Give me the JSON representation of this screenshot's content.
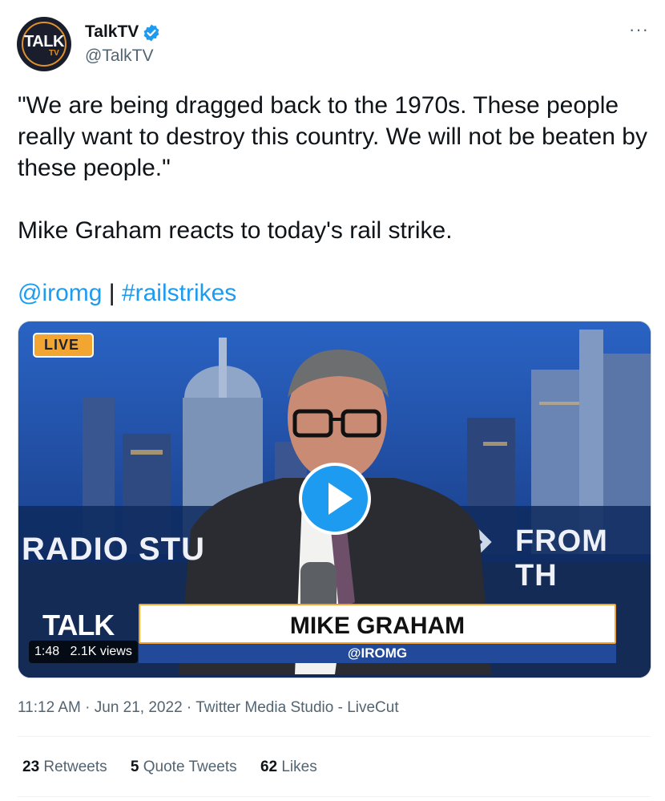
{
  "author": {
    "name": "TalkTV",
    "handle": "@TalkTV",
    "avatar_text": "TALK",
    "avatar_sub": "TV",
    "verified": true
  },
  "more_icon": "···",
  "tweet": {
    "line1": "\"We are being dragged back to the 1970s. These people really want to destroy this country. We will not be beaten by these people.\"",
    "line2": "Mike Graham reacts to today's rail strike.",
    "mention": "@iromg",
    "separator": " | ",
    "hashtag": "#railstrikes"
  },
  "video": {
    "live_label": "LIVE",
    "bg_left_text": "RADIO STU",
    "bg_right_text": "FROM TH",
    "logo_text": "TALK",
    "lower_third_name": "MIKE GRAHAM",
    "lower_third_tag": "@IROMG",
    "duration": "1:48",
    "views": "2.1K views"
  },
  "meta": {
    "time": "11:12 AM",
    "sep": " · ",
    "date": "Jun 21, 2022",
    "source": "Twitter Media Studio - LiveCut"
  },
  "stats": {
    "retweets_count": "23",
    "retweets_label": "Retweets",
    "quotes_count": "5",
    "quotes_label": "Quote Tweets",
    "likes_count": "62",
    "likes_label": "Likes"
  },
  "colors": {
    "accent": "#1d9bf0",
    "text": "#0f1419",
    "muted": "#536471",
    "talk_orange": "#f3a531"
  }
}
